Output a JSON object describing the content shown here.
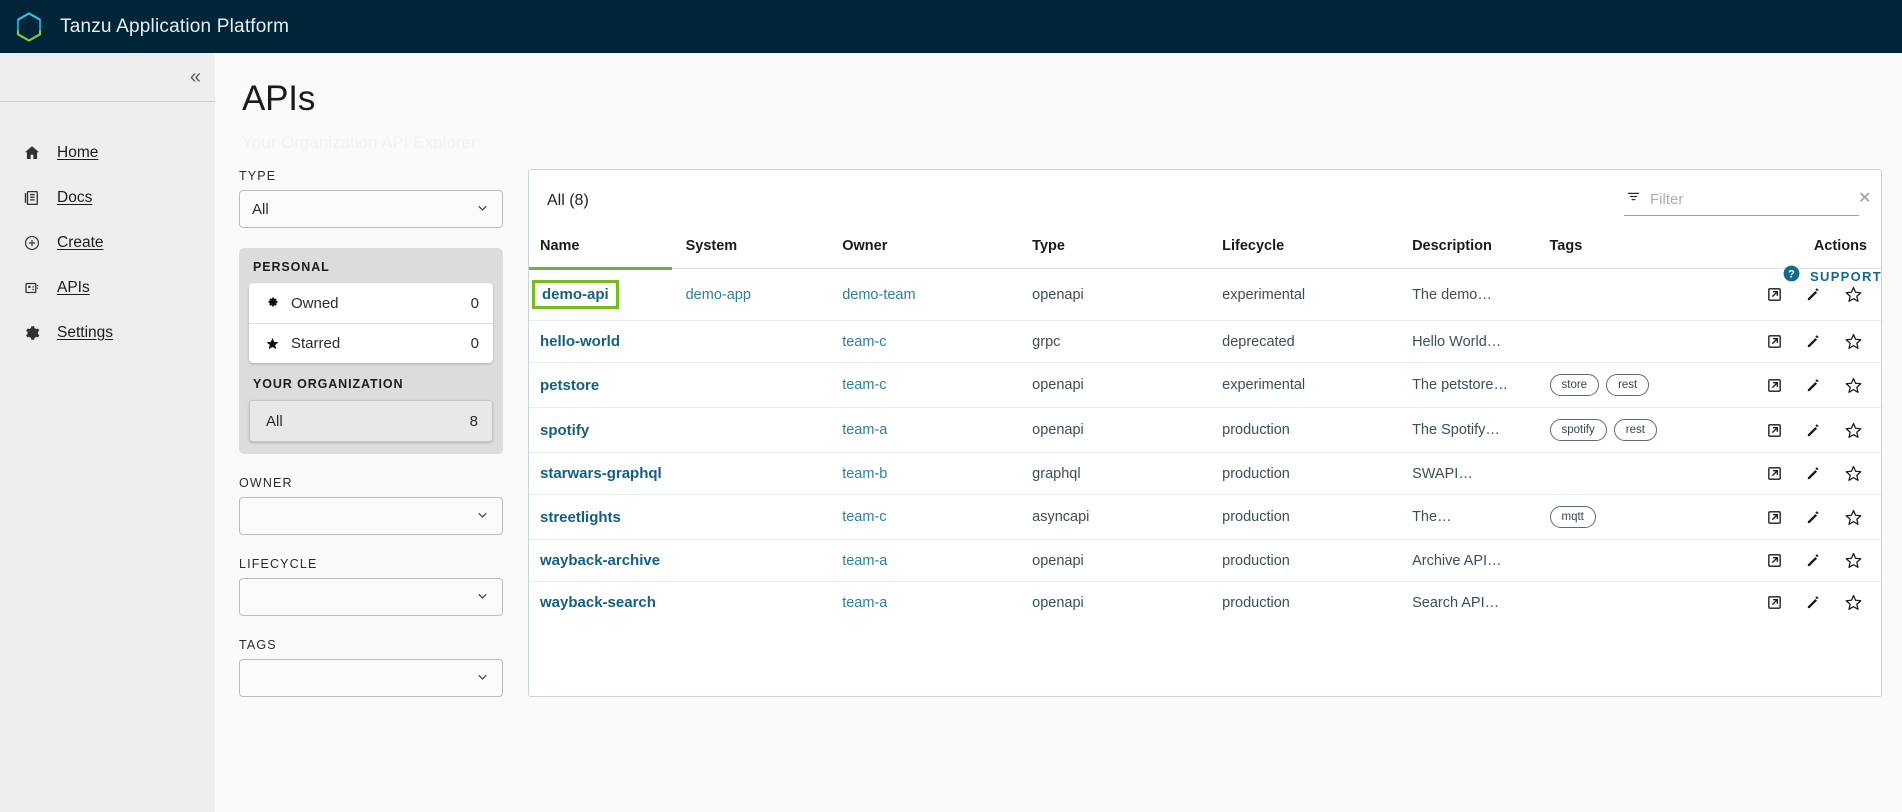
{
  "app": {
    "brand_title": "Tanzu Application Platform",
    "logo_icon": "tanzu-hexagon-logo"
  },
  "sidebar": {
    "collapse_icon": "double-chevron-left-icon",
    "items": [
      {
        "label": "Home",
        "icon": "home-icon"
      },
      {
        "label": "Docs",
        "icon": "docs-icon"
      },
      {
        "label": "Create",
        "icon": "plus-circle-icon"
      },
      {
        "label": "APIs",
        "icon": "apis-grid-icon"
      },
      {
        "label": "Settings",
        "icon": "gear-icon"
      }
    ]
  },
  "page": {
    "title": "APIs",
    "subtitle": "Your Organization API Explorer",
    "support_label": "SUPPORT",
    "support_icon": "help-circle-icon"
  },
  "filters": {
    "type": {
      "label": "TYPE",
      "value": "All"
    },
    "personal": {
      "heading": "PERSONAL",
      "rows": [
        {
          "label": "Owned",
          "count": "0",
          "icon": "gear-icon"
        },
        {
          "label": "Starred",
          "count": "0",
          "icon": "star-filled-icon"
        }
      ]
    },
    "organization": {
      "heading": "YOUR ORGANIZATION",
      "rows": [
        {
          "label": "All",
          "count": "8"
        }
      ]
    },
    "owner": {
      "label": "OWNER",
      "value": ""
    },
    "lifecycle": {
      "label": "LIFECYCLE",
      "value": ""
    },
    "tags": {
      "label": "TAGS",
      "value": ""
    }
  },
  "table": {
    "count_label": "All (8)",
    "filter_placeholder": "Filter",
    "filter_value": "",
    "filter_icon": "funnel-icon",
    "clear_icon": "close-icon",
    "columns": [
      "Name",
      "System",
      "Owner",
      "Type",
      "Lifecycle",
      "Description",
      "Tags",
      "Actions"
    ],
    "sorted_column": "Name",
    "action_icons": [
      "open-external-icon",
      "edit-pencil-icon",
      "star-outline-icon"
    ],
    "rows": [
      {
        "name": "demo-api",
        "highlighted": true,
        "system": "demo-app",
        "owner": "demo-team",
        "type": "openapi",
        "lifecycle": "experimental",
        "description": "The demo…",
        "tags": []
      },
      {
        "name": "hello-world",
        "highlighted": false,
        "system": "",
        "owner": "team-c",
        "type": "grpc",
        "lifecycle": "deprecated",
        "description": "Hello World…",
        "tags": []
      },
      {
        "name": "petstore",
        "highlighted": false,
        "system": "",
        "owner": "team-c",
        "type": "openapi",
        "lifecycle": "experimental",
        "description": "The petstore…",
        "tags": [
          "store",
          "rest"
        ]
      },
      {
        "name": "spotify",
        "highlighted": false,
        "system": "",
        "owner": "team-a",
        "type": "openapi",
        "lifecycle": "production",
        "description": "The Spotify…",
        "tags": [
          "spotify",
          "rest"
        ]
      },
      {
        "name": "starwars-graphql",
        "highlighted": false,
        "system": "",
        "owner": "team-b",
        "type": "graphql",
        "lifecycle": "production",
        "description": "SWAPI…",
        "tags": []
      },
      {
        "name": "streetlights",
        "highlighted": false,
        "system": "",
        "owner": "team-c",
        "type": "asyncapi",
        "lifecycle": "production",
        "description": "The…",
        "tags": [
          "mqtt"
        ]
      },
      {
        "name": "wayback-archive",
        "highlighted": false,
        "system": "",
        "owner": "team-a",
        "type": "openapi",
        "lifecycle": "production",
        "description": "Archive API…",
        "tags": []
      },
      {
        "name": "wayback-search",
        "highlighted": false,
        "system": "",
        "owner": "team-a",
        "type": "openapi",
        "lifecycle": "production",
        "description": "Search API…",
        "tags": []
      }
    ]
  },
  "colors": {
    "topbar_bg": "#002538",
    "accent_green": "#77bc1f",
    "link_blue": "#15607f",
    "support_blue": "#16688c"
  }
}
